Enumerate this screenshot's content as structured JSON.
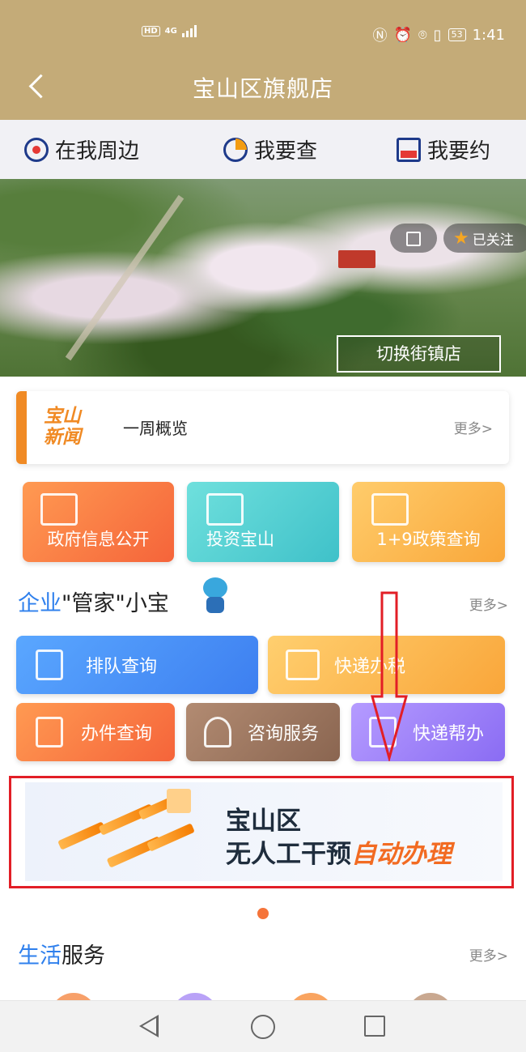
{
  "status_bar": {
    "hd": "HD",
    "net": "4G",
    "battery": "53",
    "time": "1:41"
  },
  "header": {
    "title": "宝山区旗舰店"
  },
  "tabs": [
    {
      "label": "在我周边",
      "icon": "location-pin-icon"
    },
    {
      "label": "我要查",
      "icon": "search-icon"
    },
    {
      "label": "我要约",
      "icon": "calendar-icon"
    }
  ],
  "hero": {
    "follow_label": "已关注",
    "switch_label": "切换街镇店"
  },
  "news": {
    "logo": "宝山\n新闻",
    "logo_line1": "宝山",
    "logo_line2": "新闻",
    "text": "一周概览",
    "more": "更多>"
  },
  "service_cards": [
    {
      "label": "政府信息公开"
    },
    {
      "label": "投资宝山"
    },
    {
      "label": "1+9政策查询"
    }
  ],
  "enterprise": {
    "title_blue": "企业",
    "title_rest": "\"管家\"小宝",
    "more": "更多>"
  },
  "action_tiles": [
    {
      "label": "排队查询"
    },
    {
      "label": "快递办税"
    },
    {
      "label": "办件查询"
    },
    {
      "label": "咨询服务"
    },
    {
      "label": "快递帮办"
    }
  ],
  "promo": {
    "line1": "宝山区",
    "line2_prefix": "无人工干预",
    "line2_highlight": "自动办理"
  },
  "life": {
    "title_blue": "生活",
    "title_rest": "服务",
    "more": "更多>"
  },
  "colors": {
    "header_bg": "#c4ab78",
    "accent_blue": "#2f80ed",
    "accent_orange": "#f08a24",
    "annotation_red": "#e21e26"
  }
}
